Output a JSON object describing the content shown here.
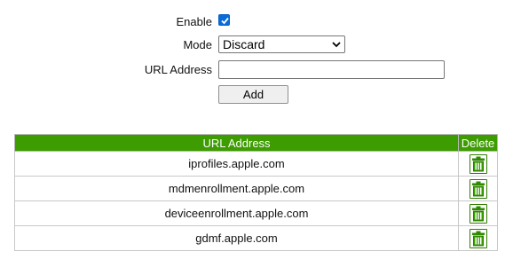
{
  "form": {
    "enable_label": "Enable",
    "enable_checked": true,
    "mode_label": "Mode",
    "mode_value": "Discard",
    "url_label": "URL Address",
    "url_value": "",
    "add_label": "Add"
  },
  "table": {
    "header_url": "URL Address",
    "header_delete": "Delete",
    "rows": [
      {
        "url": "iprofiles.apple.com"
      },
      {
        "url": "mdmenrollment.apple.com"
      },
      {
        "url": "deviceenrollment.apple.com"
      },
      {
        "url": "gdmf.apple.com"
      }
    ]
  },
  "colors": {
    "header_bg": "#3c9c00",
    "checkbox": "#0a6ad8",
    "trash_icon": "#2e8b00"
  }
}
